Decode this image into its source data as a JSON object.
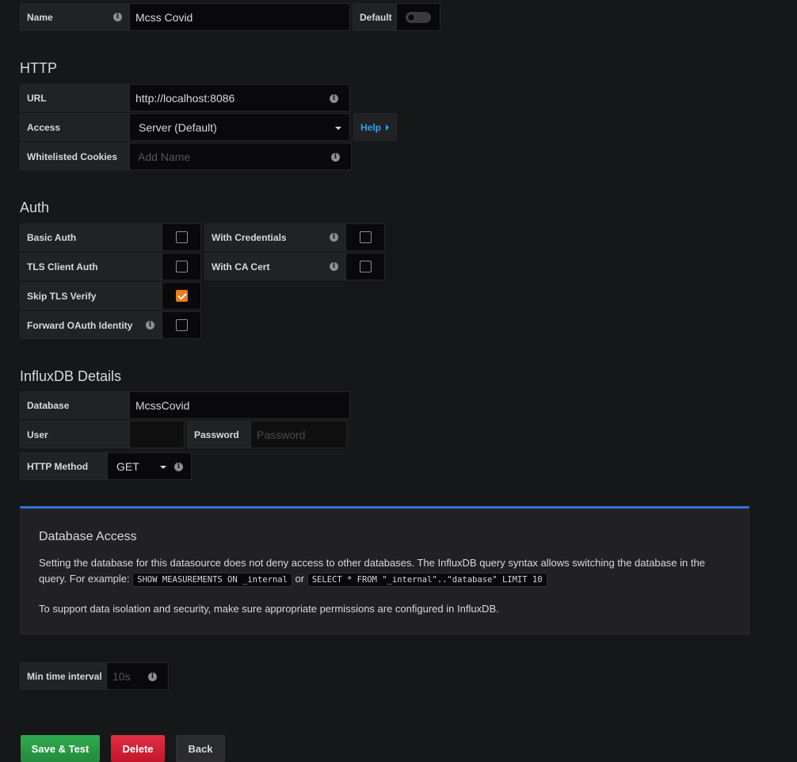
{
  "settings": {
    "name_label": "Name",
    "name_value": "Mcss Covid",
    "default_label": "Default",
    "default_on": false
  },
  "http": {
    "title": "HTTP",
    "url_label": "URL",
    "url_value": "http://localhost:8086",
    "access_label": "Access",
    "access_value": "Server (Default)",
    "help_label": "Help",
    "cookies_label": "Whitelisted Cookies",
    "cookies_placeholder": "Add Name"
  },
  "auth": {
    "title": "Auth",
    "basic_auth": {
      "label": "Basic Auth",
      "checked": false
    },
    "with_credentials": {
      "label": "With Credentials",
      "checked": false
    },
    "tls_client_auth": {
      "label": "TLS Client Auth",
      "checked": false
    },
    "with_ca_cert": {
      "label": "With CA Cert",
      "checked": false
    },
    "skip_tls_verify": {
      "label": "Skip TLS Verify",
      "checked": true
    },
    "forward_oauth": {
      "label": "Forward OAuth Identity",
      "checked": false
    }
  },
  "influx": {
    "title": "InfluxDB Details",
    "database_label": "Database",
    "database_value": "McssCovid",
    "user_label": "User",
    "user_value": "",
    "password_label": "Password",
    "password_placeholder": "Password",
    "method_label": "HTTP Method",
    "method_value": "GET"
  },
  "notice": {
    "title": "Database Access",
    "text1": "Setting the database for this datasource does not deny access to other databases. The InfluxDB query syntax allows switching the database in the query. For example:",
    "code1": "SHOW MEASUREMENTS ON _internal",
    "or": "or",
    "code2": "SELECT * FROM \"_internal\"..\"database\" LIMIT 10",
    "text2": "To support data isolation and security, make sure appropriate permissions are configured in InfluxDB."
  },
  "interval": {
    "label": "Min time interval",
    "placeholder": "10s"
  },
  "buttons": {
    "save": "Save & Test",
    "delete": "Delete",
    "back": "Back"
  },
  "colors": {
    "background": "#161719",
    "save": "#299c46",
    "delete": "#d44a3a",
    "accent": "#33a2e5",
    "checkbox": "#eb7b18"
  },
  "icons": {
    "info": "info-circle-icon",
    "caret": "caret-down-icon",
    "help_arrow": "caret-right-icon"
  }
}
